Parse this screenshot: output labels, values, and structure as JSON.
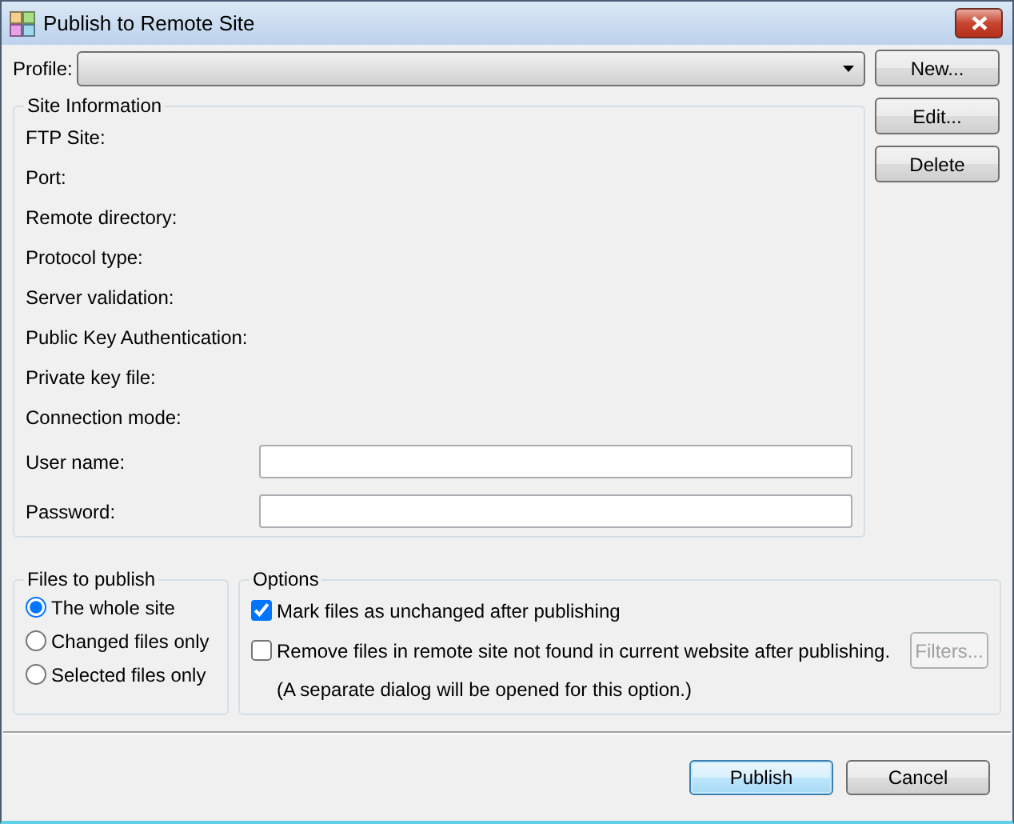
{
  "window": {
    "title": "Publish to Remote Site"
  },
  "profile": {
    "label": "Profile:"
  },
  "profile_buttons": [
    {
      "label": "New..."
    },
    {
      "label": "Edit..."
    },
    {
      "label": "Delete"
    }
  ],
  "site_information": {
    "title": "Site Information",
    "fields": [
      {
        "label": "FTP Site:",
        "kind": "info"
      },
      {
        "label": "Port:",
        "kind": "info"
      },
      {
        "label": "Remote directory:",
        "kind": "info"
      },
      {
        "label": "Protocol type:",
        "kind": "info"
      },
      {
        "label": "Server validation:",
        "kind": "info"
      },
      {
        "label": "Public Key Authentication:",
        "kind": "info"
      },
      {
        "label": "Private key file:",
        "kind": "info"
      },
      {
        "label": "Connection mode:",
        "kind": "info"
      },
      {
        "label": "User name:",
        "kind": "input"
      },
      {
        "label": "Password:",
        "kind": "input"
      }
    ]
  },
  "files_to_publish": {
    "title": "Files to publish",
    "options": [
      {
        "label": "The whole site",
        "selected": true
      },
      {
        "label": "Changed files only",
        "selected": false
      },
      {
        "label": "Selected files only",
        "selected": false
      }
    ]
  },
  "options": {
    "title": "Options",
    "items": [
      {
        "label": "Mark files as unchanged after publishing",
        "checked": true
      },
      {
        "label": "Remove files in remote site not found in current website after publishing.",
        "checked": false
      }
    ],
    "filters_button": {
      "label": "Filters...",
      "disabled": true
    },
    "note": "(A separate dialog will be opened for this option.)"
  },
  "buttons": [
    {
      "label": "Publish",
      "default": true
    },
    {
      "label": "Cancel",
      "default": false
    }
  ]
}
